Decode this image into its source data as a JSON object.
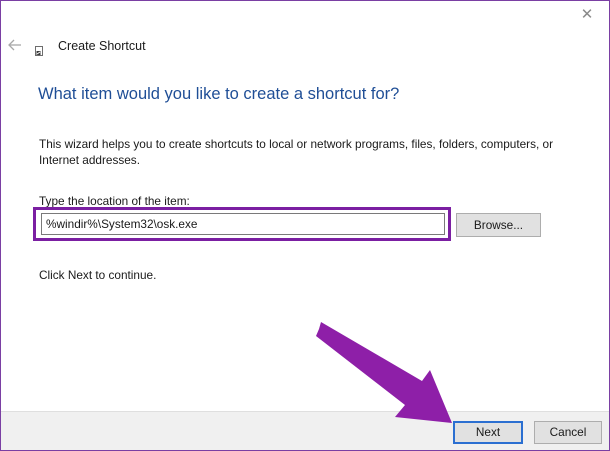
{
  "window": {
    "title": "Create Shortcut",
    "close_glyph": "✕",
    "icons": [
      "close-icon",
      "back-arrow-icon",
      "shortcut-app-icon",
      "annotation-arrow"
    ]
  },
  "wizard": {
    "heading": "What item would you like to create a shortcut for?",
    "description": "This wizard helps you to create shortcuts to local or network programs, files, folders, computers, or Internet addresses.",
    "location_label": "Type the location of the item:",
    "location_value": "%windir%\\System32\\osk.exe",
    "browse_label": "Browse...",
    "continue_text": "Click Next to continue."
  },
  "footer": {
    "next_label": "Next",
    "cancel_label": "Cancel"
  },
  "colors": {
    "heading": "#1f4e96",
    "highlight": "#7b1fa2",
    "default_button_border": "#2b6fd1",
    "window_border": "#7a3fa3"
  }
}
